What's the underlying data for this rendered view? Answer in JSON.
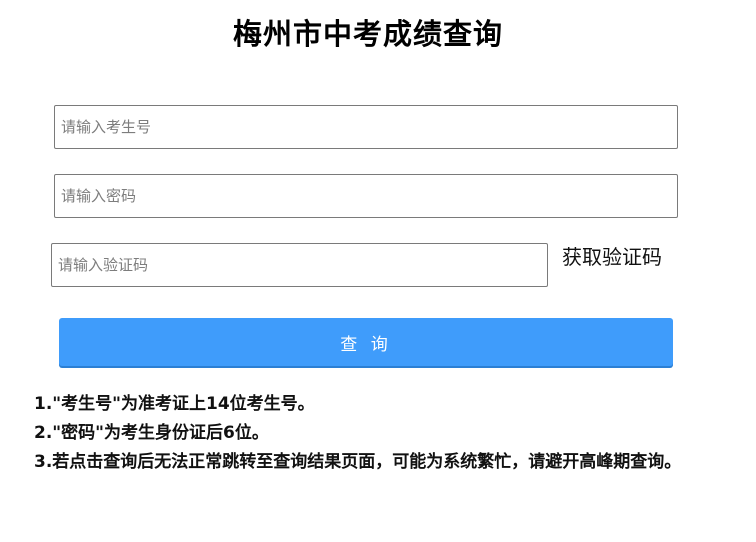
{
  "header": {
    "title": "梅州市中考成绩查询"
  },
  "form": {
    "student_id_placeholder": "请输入考生号",
    "password_placeholder": "请输入密码",
    "captcha_placeholder": "请输入验证码",
    "get_captcha_label": "获取验证码",
    "submit_label": "查 询"
  },
  "notes": [
    "1.\"考生号\"为准考证上14位考生号。",
    "2.\"密码\"为考生身份证后6位。",
    "3.若点击查询后无法正常跳转至查询结果页面，可能为系统繁忙，请避开高峰期查询。"
  ],
  "colors": {
    "button_background": "#3f9cfb",
    "button_text": "#ffffff",
    "field_border": "#7a7a7a"
  }
}
